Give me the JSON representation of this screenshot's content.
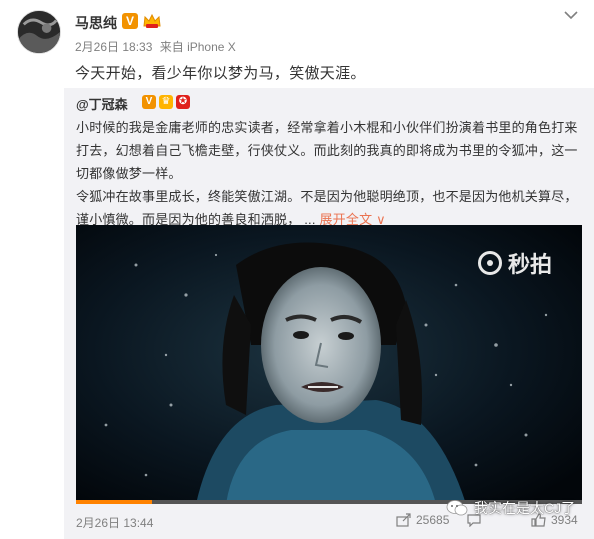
{
  "post": {
    "user_name": "马思纯",
    "verified_icon": "V",
    "vip_icon": "vip-crown-icon",
    "date": "2月26日 18:33",
    "source": "来自 iPhone X",
    "text": "今天开始，看少年你以梦为马，笑傲天涯。"
  },
  "repost": {
    "author": "@丁冠森",
    "text_main": "小时候的我是金庸老师的忠实读者，经常拿着小木棍和小伙伴们扮演着书里的角色打来打去，幻想着自己飞檐走壁，行侠仗义。而此刻的我真的即将成为书里的令狐冲，这一切都像做梦一样。",
    "text_second": "令狐冲在故事里成长，终能笑傲江湖。不是因为他聪明绝顶，也不是因为他机关算尽，谨小慎微。而是因为他的善良和洒脱，",
    "ellipsis": "...",
    "expand_label": "展开全文",
    "expand_arrow": "∨",
    "video_watermark": "秒拍",
    "video_progress_fraction": 0.15,
    "date": "2月26日 13:44",
    "repost_count": "25685",
    "comment_count": "",
    "like_count": "3934"
  },
  "watermark": {
    "text": "我实在是太CJ了"
  },
  "colors": {
    "accent": "#eb7350",
    "verified": "#f29200",
    "repost_bg": "#f2f2f5",
    "progress": "#ff8200"
  }
}
